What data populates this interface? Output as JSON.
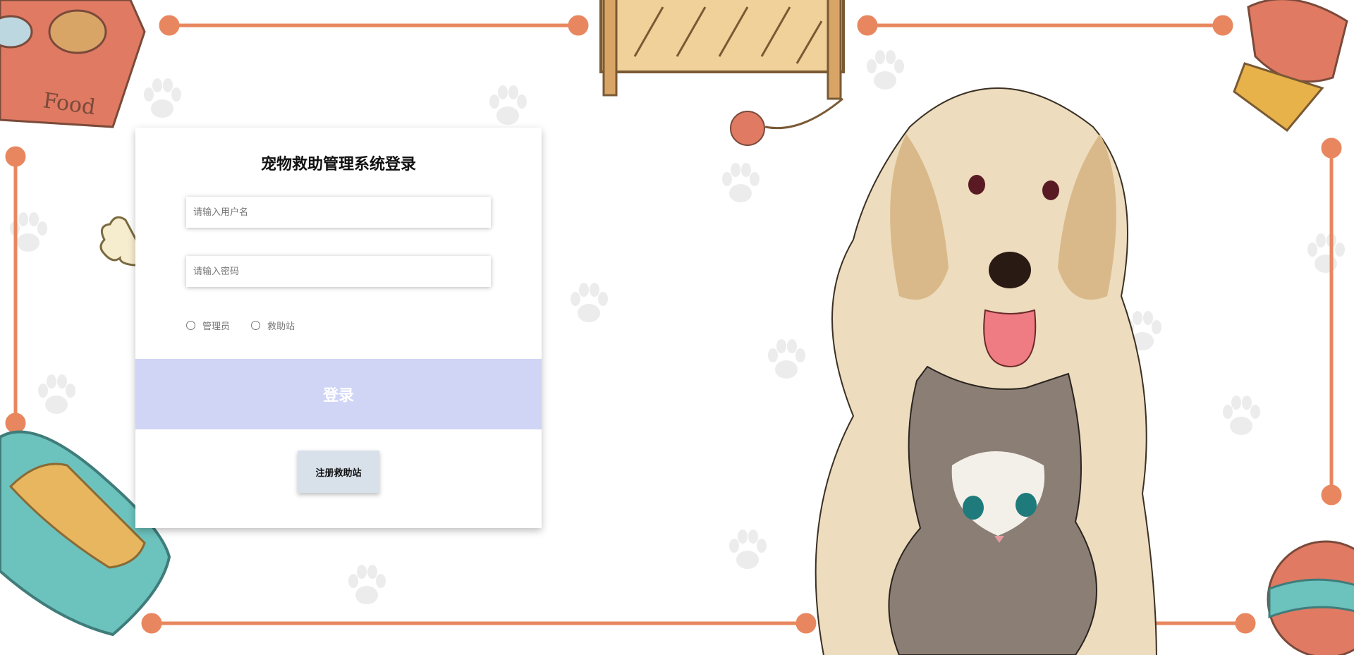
{
  "login": {
    "title": "宠物救助管理系统登录",
    "username_placeholder": "请输入用户名",
    "password_placeholder": "请输入密码",
    "roles": [
      {
        "label": "管理员",
        "selected": false
      },
      {
        "label": "救助站",
        "selected": false
      }
    ],
    "login_label": "登录",
    "register_label": "注册救助站"
  },
  "illustration": {
    "food_bowl_text": "Food"
  },
  "colors": {
    "frame": "#e8875f",
    "login_button": "#d0d5f6",
    "register_button": "#d8e0ea"
  }
}
